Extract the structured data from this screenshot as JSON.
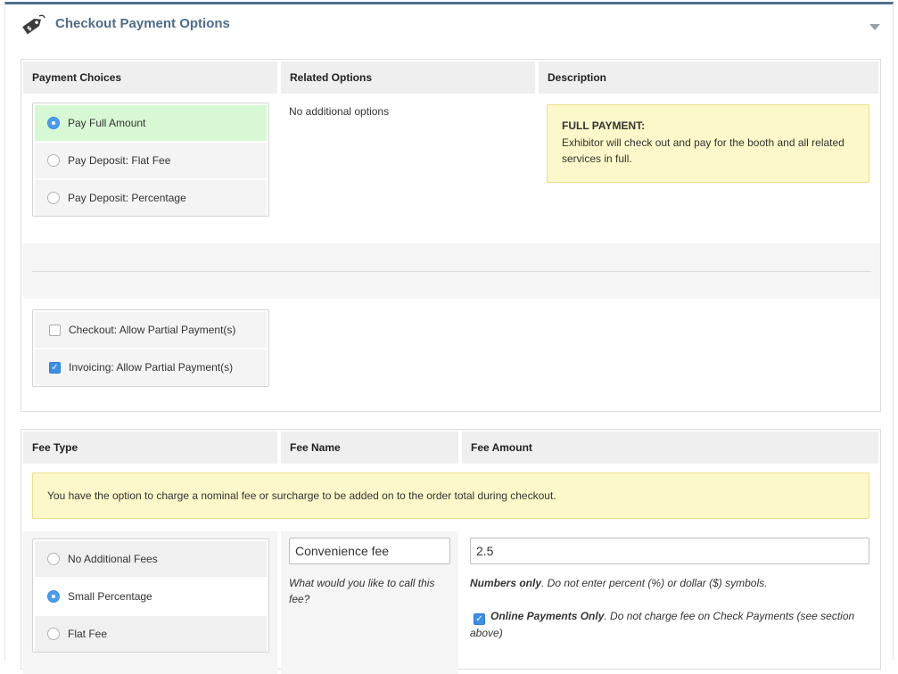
{
  "header": {
    "title": "Checkout Payment Options"
  },
  "payment_section": {
    "columns": [
      "Payment Choices",
      "Related Options",
      "Description"
    ],
    "choices": [
      {
        "label": "Pay Full Amount",
        "selected": true
      },
      {
        "label": "Pay Deposit: Flat Fee",
        "selected": false
      },
      {
        "label": "Pay Deposit: Percentage",
        "selected": false
      }
    ],
    "related_options_text": "No additional options",
    "description_title": "FULL PAYMENT:",
    "description_body": "Exhibitor will check out and pay for the booth and all related services in full.",
    "partial_options": [
      {
        "label": "Checkout: Allow Partial Payment(s)",
        "checked": false
      },
      {
        "label": "Invoicing: Allow Partial Payment(s)",
        "checked": true
      }
    ]
  },
  "fee_section": {
    "columns": [
      "Fee Type",
      "Fee Name",
      "Fee Amount"
    ],
    "notice": "You have the option to charge a nominal fee or surcharge to be added on to the order total during checkout.",
    "fee_types": [
      {
        "label": "No Additional Fees",
        "selected": false
      },
      {
        "label": "Small Percentage",
        "selected": true
      },
      {
        "label": "Flat Fee",
        "selected": false
      }
    ],
    "fee_name_value": "Convenience fee",
    "fee_name_hint": "What would you like to call this fee?",
    "fee_amount_value": "2.5",
    "fee_amount_hint_bold": "Numbers only",
    "fee_amount_hint_rest": ". Do not enter percent (%) or dollar ($) symbols.",
    "online_only_bold": "Online Payments Only",
    "online_only_rest": ". Do not charge fee on Check Payments (see section above)",
    "online_only_checked": true
  },
  "colors": {
    "title_blue": "#4f6d8c",
    "selected_green": "#d6f8d3",
    "note_yellow": "#fdf8c9",
    "radio_blue": "#4a9cf0"
  }
}
